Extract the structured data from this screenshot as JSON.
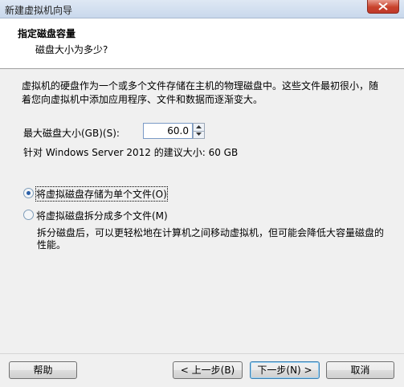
{
  "window": {
    "title": "新建虚拟机向导"
  },
  "header": {
    "title": "指定磁盘容量",
    "subtitle": "磁盘大小为多少?"
  },
  "description": "虚拟机的硬盘作为一个或多个文件存储在主机的物理磁盘中。这些文件最初很小，随着您向虚拟机中添加应用程序、文件和数据而逐渐变大。",
  "disk": {
    "size_label": "最大磁盘大小(GB)(S):",
    "size_value": "60.0",
    "recommend_text": "针对 Windows Server 2012 的建议大小: 60 GB"
  },
  "options": [
    {
      "label": "将虚拟磁盘存储为单个文件(O)",
      "checked": true
    },
    {
      "label": "将虚拟磁盘拆分成多个文件(M)",
      "checked": false
    }
  ],
  "split_note": "拆分磁盘后，可以更轻松地在计算机之间移动虚拟机，但可能会降低大容量磁盘的性能。",
  "buttons": {
    "help": "帮助",
    "back": "< 上一步(B)",
    "next": "下一步(N) >",
    "cancel": "取消"
  },
  "icons": {
    "close": "close-icon",
    "spin_up": "spin-up-icon",
    "spin_down": "spin-down-icon"
  }
}
